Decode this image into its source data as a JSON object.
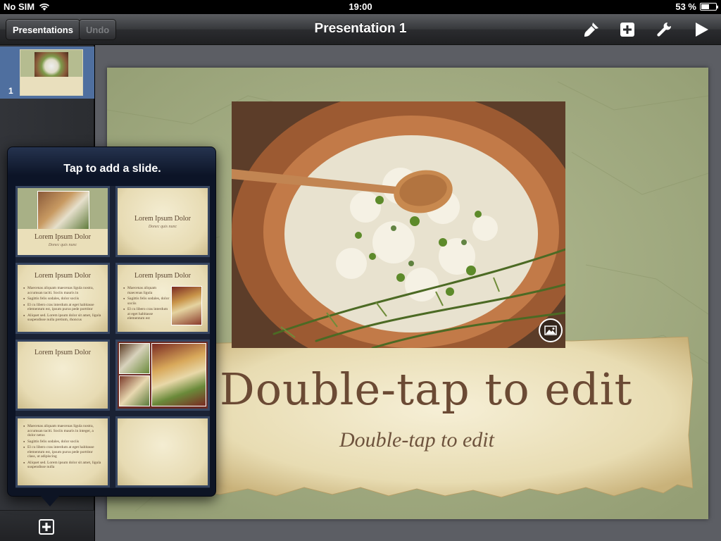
{
  "status_bar": {
    "carrier": "No SIM",
    "time": "19:00",
    "battery": "53 %",
    "battery_level": 0.53
  },
  "toolbar": {
    "presentations_label": "Presentations",
    "undo_label": "Undo",
    "title": "Presentation 1",
    "icons": [
      "paintbrush-icon",
      "add-icon",
      "wrench-icon",
      "play-icon"
    ]
  },
  "sidebar": {
    "slides": [
      {
        "number": "1"
      }
    ]
  },
  "slide": {
    "title": "Double-tap to edit",
    "subtitle": "Double-tap to edit"
  },
  "popover": {
    "title": "Tap to add a slide.",
    "layouts": [
      {
        "title": "Lorem Ipsum Dolor",
        "subtitle": "Donec quis nunc"
      },
      {
        "title": "Lorem Ipsum Dolor",
        "subtitle": "Donec quis nunc"
      },
      {
        "title": "Lorem Ipsum Dolor",
        "bullets": [
          "Maecenas aliquam maecenas ligula nostra, accumsan taciti. Sociis mauris in",
          "Sagittis felis sodales, dolor sociis",
          "El cu libero cras interdum at eget habitasse elementum est, ipsum purus pede porttitor",
          "Aliquet sed. Lorem ipsum dolor sit amet, ligula suspendisse nulla pretium, rhoncus"
        ]
      },
      {
        "title": "Lorem Ipsum Dolor",
        "bullets": [
          "Maecenas aliquam maecenas ligula",
          "Sagittis felis sodales, dolor sociis",
          "El cu libero cras interdum at eget habitasse elementum est"
        ]
      },
      {
        "title": "Lorem Ipsum Dolor"
      },
      {
        "title": ""
      },
      {
        "bullets": [
          "Maecenas aliquam maecenas ligula nostra, accumsan taciti. Sociis mauris in integer, a dolor netus",
          "Sagittis felis sodales, dolor sociis",
          "El cu libero cras interdum at eget habitasse elementum est, ipsum purus pede porttitor class, ut adipiscing",
          "Aliquet sed. Lorem ipsum dolor sit amet, ligula suspendisse nulla"
        ]
      },
      {
        "title": ""
      }
    ]
  },
  "colors": {
    "slide_bg": "#a2ac82",
    "paper": "#ede2bf",
    "title_text": "#6b4a34",
    "popover_bg": "#0d1424",
    "selected_thumb": "#4f6f9f"
  }
}
